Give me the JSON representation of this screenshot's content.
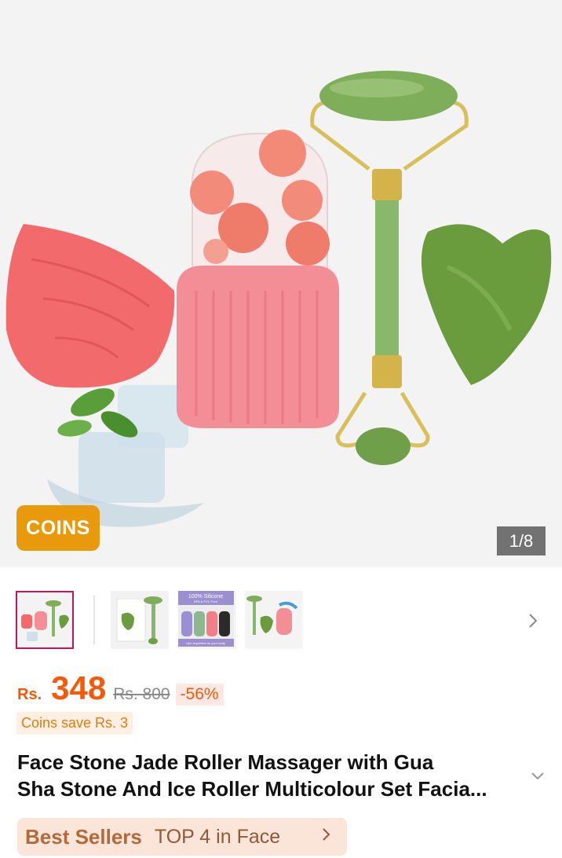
{
  "hero": {
    "badge": "COINS",
    "counter": "1/8"
  },
  "thumbs": {
    "third_caption_top": "100% Silicone",
    "third_caption_sub": "BPA & PVC Free",
    "third_caption_bottom": "Use anywhere on your body",
    "more_icon": "chevron-right-icon"
  },
  "pricing": {
    "currency": "Rs.",
    "price": "348",
    "original": "Rs. 800",
    "discount": "-56%"
  },
  "coins_save": "Coins save Rs. 3",
  "product": {
    "title_line1": "Face Stone Jade Roller Massager with Gua",
    "title_line2": "Sha Stone And Ice Roller Multicolour Set Facia..."
  },
  "best_sellers": {
    "label": "Best Sellers",
    "rank": "TOP 4 in Face"
  },
  "colors": {
    "accent": "#f55a0a",
    "badge": "#e89a0c",
    "active_thumb_border": "#c2185b"
  }
}
